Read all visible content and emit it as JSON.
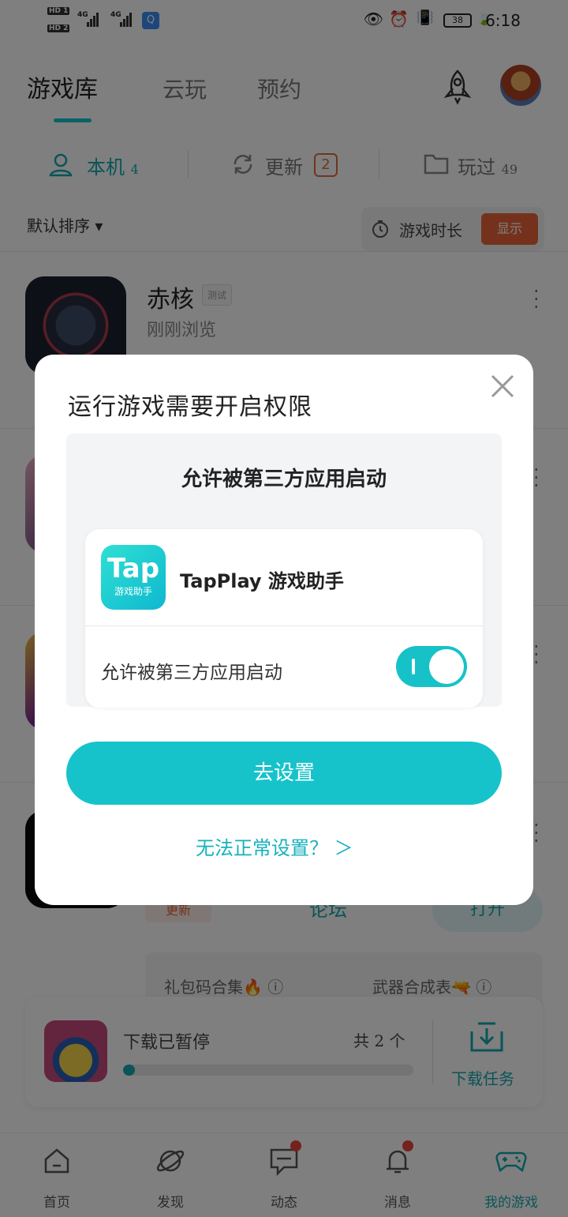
{
  "status_bar": {
    "hd1": "HD 1",
    "hd2": "HD 2",
    "net1": "4G",
    "net2": "4G",
    "battery": "38",
    "time": "6:18"
  },
  "top_tabs": [
    "游戏库",
    "云玩",
    "预约"
  ],
  "sub_tabs": {
    "local_label": "本机",
    "local_count": "4",
    "update_label": "更新",
    "update_count": "2",
    "played_label": "玩过",
    "played_count": "49"
  },
  "sort": {
    "label": "默认排序 ▾"
  },
  "play_time": {
    "label": "游戏时长",
    "button": "显示"
  },
  "games": [
    {
      "name": "赤核",
      "tag": "测试",
      "subtitle": "刚刚浏览"
    }
  ],
  "game_actions": {
    "update_chip": "更新",
    "forum": "论坛",
    "open": "打开"
  },
  "extras": [
    "礼包码合集🔥 ⓘ",
    "武器合成表🔫 ⓘ"
  ],
  "download": {
    "status": "下载已暂停",
    "count": "共 2 个",
    "progress": 0.02,
    "task_label": "下载任务"
  },
  "bottom_nav": [
    {
      "label": "首页"
    },
    {
      "label": "发现"
    },
    {
      "label": "动态"
    },
    {
      "label": "消息"
    },
    {
      "label": "我的游戏"
    }
  ],
  "dialog": {
    "title": "运行游戏需要开启权限",
    "illustration_title": "允许被第三方应用启动",
    "app_icon_top": "Tap",
    "app_icon_bottom": "游戏助手",
    "app_name": "TapPlay 游戏助手",
    "toggle_label": "允许被第三方应用启动",
    "toggle_on": true,
    "go_button": "去设置",
    "help_link": "无法正常设置？ ＞"
  },
  "colors": {
    "accent": "#16c3cb",
    "orange": "#e8643a",
    "red_dot": "#e8453c"
  }
}
